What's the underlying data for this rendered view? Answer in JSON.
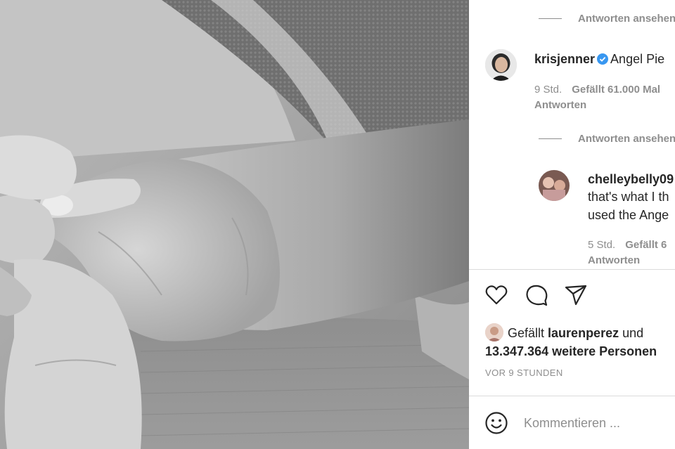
{
  "post": {
    "image": {
      "description_icon": "photo-of-baby-hands"
    }
  },
  "comments": {
    "view_replies_top": "Antworten ansehen",
    "items": [
      {
        "username": "krisjenner",
        "verified": true,
        "text": "Angel Pie",
        "time": "9 Std.",
        "likes": "Gefällt 61.000 Mal",
        "reply": "Antworten"
      }
    ],
    "view_replies_mid": "Antworten ansehen",
    "replies": [
      {
        "username": "chelleybelly09",
        "text_line1": "that's what I th",
        "text_line2": "used the Ange",
        "time": "5 Std.",
        "likes": "Gefällt 6",
        "reply": "Antworten"
      }
    ]
  },
  "actions": {
    "like_icon": "heart-icon",
    "comment_icon": "comment-icon",
    "share_icon": "paper-plane-icon"
  },
  "likes": {
    "prefix": "Gefällt",
    "user": "laurenperez",
    "conj": "und",
    "count": "13.347.364 weitere Personen"
  },
  "timestamp": "VOR 9 STUNDEN",
  "comment_box": {
    "emoji_icon": "smiley-icon",
    "placeholder": "Kommentieren ..."
  },
  "colors": {
    "text": "#262626",
    "muted": "#8e8e8e",
    "verified": "#3897f0",
    "divider": "#dbdbdb"
  }
}
